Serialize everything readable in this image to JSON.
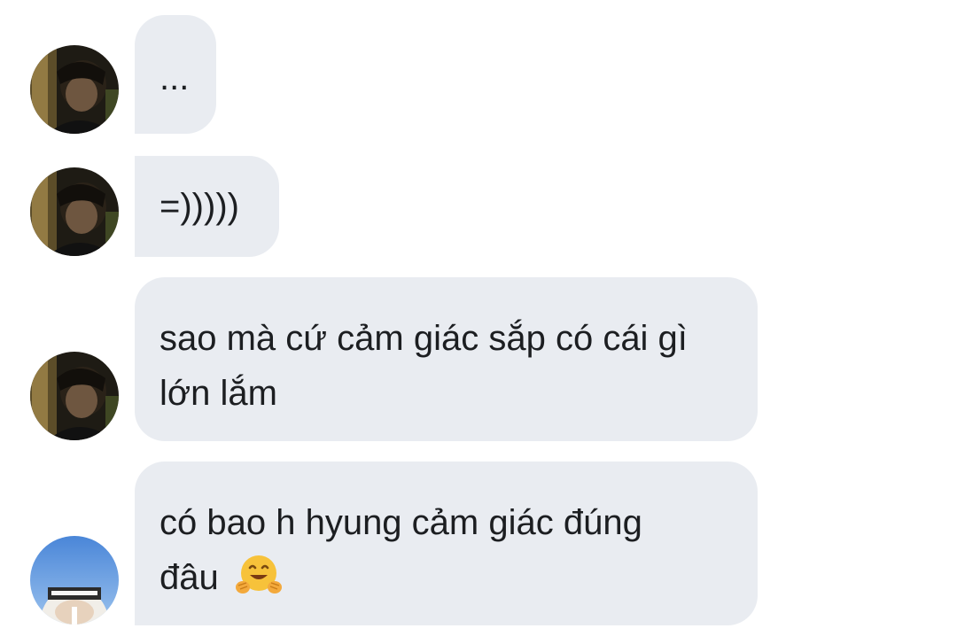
{
  "messages": [
    {
      "sender": "other",
      "text": "..."
    },
    {
      "sender": "other",
      "text": "=)))))"
    },
    {
      "sender": "other",
      "line1": "sao mà cứ cảm giác sắp có cái gì",
      "line2": "lớn lắm"
    },
    {
      "sender": "other",
      "line1": "có bao h hyung cảm giác đúng",
      "line2": "đâu",
      "emoji": "hugging-face-icon"
    }
  ],
  "colors": {
    "bubble_bg": "#e9ecf1",
    "text": "#1c1e21",
    "background": "#ffffff"
  }
}
